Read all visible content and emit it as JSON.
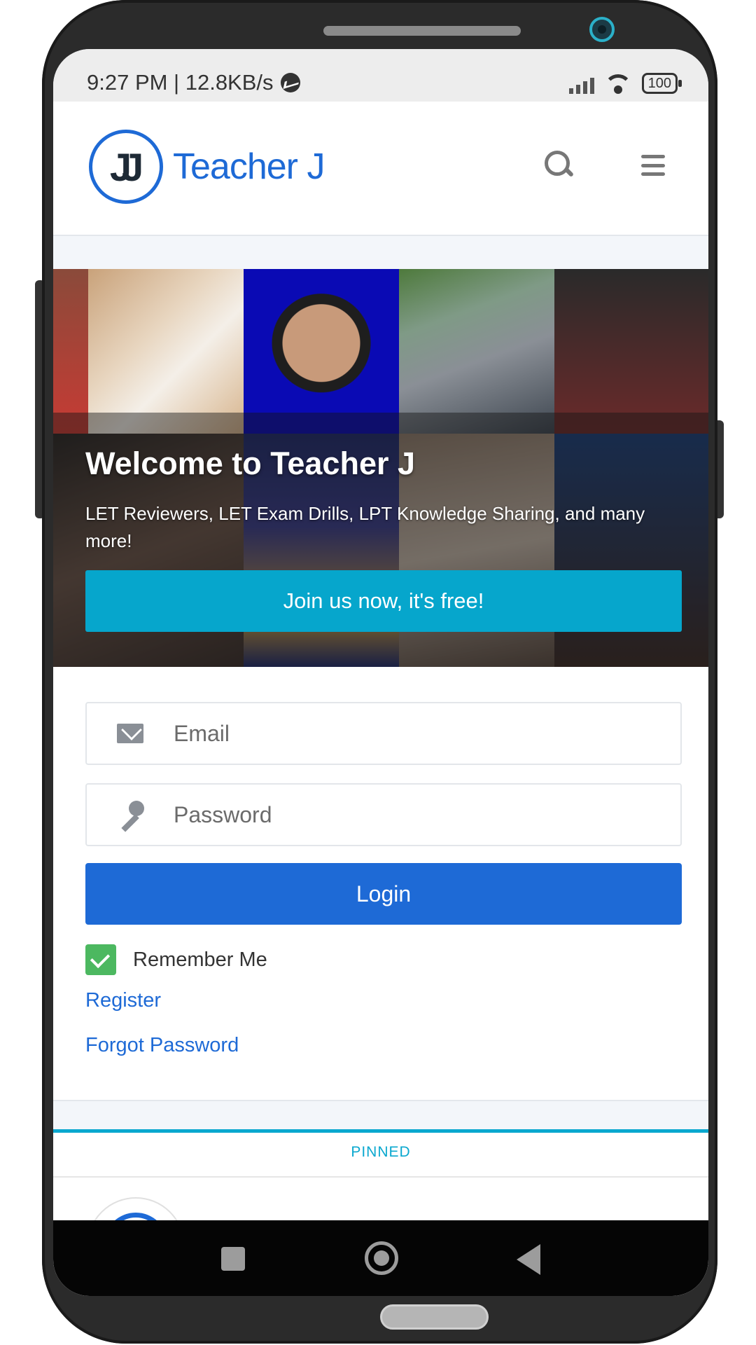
{
  "status_bar": {
    "time_speed": "9:27 PM | 12.8KB/s",
    "battery": "100"
  },
  "header": {
    "logo_mark": "JJ",
    "brand": "Teacher J"
  },
  "hero": {
    "title": "Welcome to Teacher J",
    "subtitle": "LET Reviewers, LET Exam Drills, LPT Knowledge Sharing, and many more!",
    "cta": "Join us now, it's free!"
  },
  "login": {
    "email_placeholder": "Email",
    "password_placeholder": "Password",
    "login_label": "Login",
    "remember_label": "Remember Me",
    "remember_checked": true,
    "register_link": "Register",
    "forgot_link": "Forgot Password"
  },
  "pinned": {
    "label": "PINNED"
  },
  "colors": {
    "brand_blue": "#1e6ad6",
    "cta_cyan": "#06a6cc",
    "check_green": "#4cb860"
  }
}
